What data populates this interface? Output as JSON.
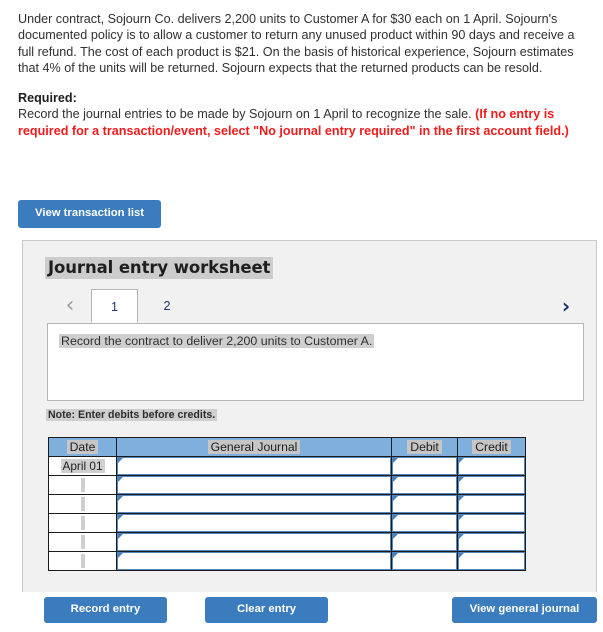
{
  "problem": {
    "text": "Under contract, Sojourn Co. delivers 2,200 units to Customer A for $30 each on 1 April. Sojourn's documented policy is to allow a customer to return any unused product within 90 days and receive a full refund. The cost of each product is $21. On the basis of historical experience, Sojourn estimates that 4% of the units will be returned. Sojourn expects that the returned products can be resold."
  },
  "required": {
    "label": "Required:",
    "text": "Record the journal entries to be made by Sojourn on 1 April to recognize the sale. ",
    "warning": "(If no entry is required for a transaction/event, select \"No journal entry required\" in the first account field.)"
  },
  "toolbar": {
    "view_transaction_list_label": "View transaction list"
  },
  "worksheet": {
    "title": "Journal entry worksheet",
    "tabs": [
      {
        "label": "1",
        "active": true
      },
      {
        "label": "2",
        "active": false
      }
    ],
    "prev_arrow": "‹",
    "next_arrow": "›",
    "description": "Record the contract to deliver 2,200 units to Customer A.",
    "note": "Note: Enter debits before credits."
  },
  "journal_table": {
    "headers": [
      "Date",
      "General Journal",
      "Debit",
      "Credit"
    ],
    "rows": [
      {
        "date": "April 01",
        "journal": "",
        "debit": "",
        "credit": ""
      },
      {
        "date": "",
        "journal": "",
        "debit": "",
        "credit": ""
      },
      {
        "date": "",
        "journal": "",
        "debit": "",
        "credit": ""
      },
      {
        "date": "",
        "journal": "",
        "debit": "",
        "credit": ""
      },
      {
        "date": "",
        "journal": "",
        "debit": "",
        "credit": ""
      },
      {
        "date": "",
        "journal": "",
        "debit": "",
        "credit": ""
      }
    ]
  },
  "footer": {
    "record_entry_label": "Record entry",
    "clear_entry_label": "Clear entry",
    "view_general_journal_label": "View general journal"
  },
  "colors": {
    "button_blue": "#3a7cbd",
    "table_header_blue": "#7fafdd",
    "warning_red": "#ee1c1c",
    "panel_gray": "#f1f1f1",
    "highlight_gray": "#cfcfcf"
  }
}
